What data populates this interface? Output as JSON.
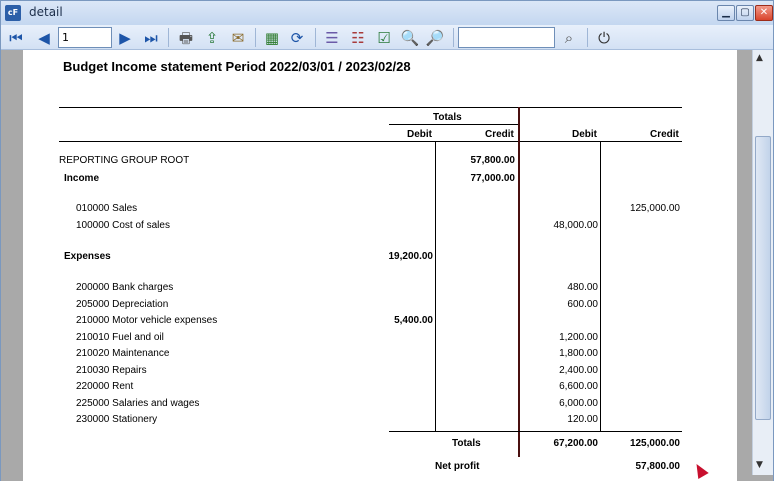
{
  "window": {
    "title": "detail",
    "icon": "app-icon"
  },
  "toolbar": {
    "page_value": "1",
    "search_value": "",
    "icons": [
      "first-page-icon",
      "prev-page-icon",
      "next-page-icon",
      "last-page-icon",
      "print-icon",
      "export-icon",
      "email-icon",
      "excel-icon",
      "refresh-icon",
      "group-tree-icon",
      "group-remove-icon",
      "group-check-icon",
      "zoom-out-icon",
      "zoom-in-icon",
      "search-icon",
      "power-icon"
    ]
  },
  "report": {
    "title": "Budget Income statement Period  2022/03/01 / 2023/02/28",
    "headers": {
      "totals": "Totals",
      "debit1": "Debit",
      "credit1": "Credit",
      "debit2": "Debit",
      "credit2": "Credit"
    },
    "rows": [
      {
        "label": "REPORTING GROUP ROOT",
        "bold": false,
        "debit1": "",
        "credit1": "57,800.00",
        "debit2": "",
        "credit2": ""
      },
      {
        "label": "Income",
        "bold": true,
        "debit1": "",
        "credit1": "77,000.00",
        "debit2": "",
        "credit2": ""
      },
      {
        "label": "010000 Sales",
        "bold": false,
        "debit1": "",
        "credit1": "",
        "debit2": "",
        "credit2": "125,000.00"
      },
      {
        "label": "100000 Cost of sales",
        "bold": false,
        "debit1": "",
        "credit1": "",
        "debit2": "48,000.00",
        "credit2": ""
      },
      {
        "label": "Expenses",
        "bold": true,
        "debit1": "19,200.00",
        "credit1": "",
        "debit2": "",
        "credit2": ""
      },
      {
        "label": "200000 Bank charges",
        "bold": false,
        "debit1": "",
        "credit1": "",
        "debit2": "480.00",
        "credit2": ""
      },
      {
        "label": "205000 Depreciation",
        "bold": false,
        "debit1": "",
        "credit1": "",
        "debit2": "600.00",
        "credit2": ""
      },
      {
        "label": "210000 Motor vehicle expenses",
        "bold": false,
        "debit1": "5,400.00",
        "credit1": "",
        "debit2": "",
        "credit2": ""
      },
      {
        "label": "210010 Fuel and oil",
        "bold": false,
        "debit1": "",
        "credit1": "",
        "debit2": "1,200.00",
        "credit2": ""
      },
      {
        "label": "210020 Maintenance",
        "bold": false,
        "debit1": "",
        "credit1": "",
        "debit2": "1,800.00",
        "credit2": ""
      },
      {
        "label": "210030 Repairs",
        "bold": false,
        "debit1": "",
        "credit1": "",
        "debit2": "2,400.00",
        "credit2": ""
      },
      {
        "label": "220000 Rent",
        "bold": false,
        "debit1": "",
        "credit1": "",
        "debit2": "6,600.00",
        "credit2": ""
      },
      {
        "label": "225000 Salaries and wages",
        "bold": false,
        "debit1": "",
        "credit1": "",
        "debit2": "6,000.00",
        "credit2": ""
      },
      {
        "label": "230000 Stationery",
        "bold": false,
        "debit1": "",
        "credit1": "",
        "debit2": "120.00",
        "credit2": ""
      }
    ],
    "totals_row": {
      "label": "Totals",
      "debit2": "67,200.00",
      "credit2": "125,000.00"
    },
    "net_profit": {
      "label": "Net profit",
      "value": "57,800.00"
    }
  }
}
